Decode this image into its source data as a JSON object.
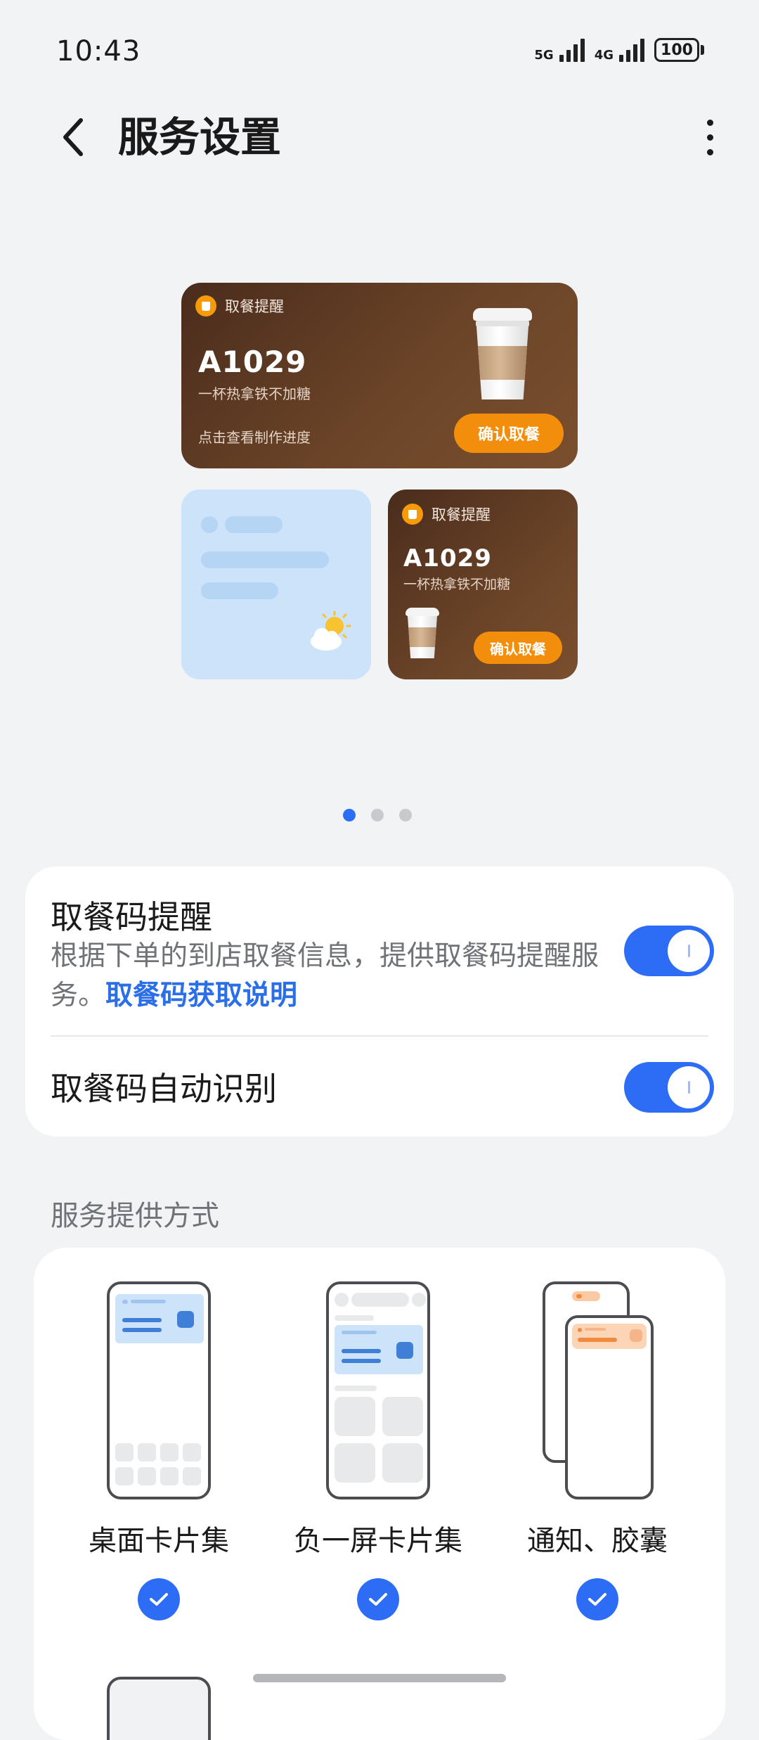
{
  "status_bar": {
    "time": "10:43",
    "net1": "5G",
    "net2": "4G",
    "battery": "100"
  },
  "header": {
    "title": "服务设置"
  },
  "preview": {
    "big_card": {
      "header": "取餐提醒",
      "code": "A1029",
      "desc": "一杯热拿铁不加糖",
      "hint": "点击查看制作进度",
      "button": "确认取餐"
    },
    "small_card": {
      "header": "取餐提醒",
      "code": "A1029",
      "desc": "一杯热拿铁不加糖",
      "button": "确认取餐"
    },
    "page_count": 3,
    "active_page": 1
  },
  "settings": {
    "item1": {
      "title": "取餐码提醒",
      "desc": "根据下单的到店取餐信息，提供取餐码提醒服务。",
      "link": "取餐码获取说明",
      "enabled": true
    },
    "item2": {
      "title": "取餐码自动识别",
      "enabled": true
    }
  },
  "service_methods": {
    "label": "服务提供方式",
    "options": [
      {
        "label": "桌面卡片集",
        "checked": true
      },
      {
        "label": "负一屏卡片集",
        "checked": true
      },
      {
        "label": "通知、胶囊",
        "checked": true
      }
    ]
  },
  "colors": {
    "accent": "#2d6df6",
    "link": "#2a6ee8",
    "orange": "#f28e0b",
    "coffee": "#5a3822"
  }
}
